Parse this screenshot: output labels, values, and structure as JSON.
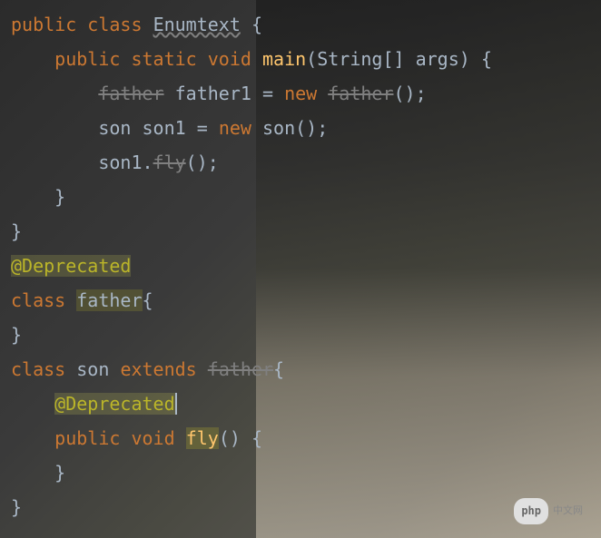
{
  "code": {
    "line1": {
      "kw_public": "public",
      "kw_class": "class",
      "classname": "Enumtext",
      "brace": "{"
    },
    "line2": {
      "kw_public": "public",
      "kw_static": "static",
      "kw_void": "void",
      "method": "main",
      "params": "(String[] args)",
      "brace": "{"
    },
    "line3": {
      "type": "father",
      "var": "father1",
      "eq": "=",
      "kw_new": "new",
      "ctor": "father",
      "call": "();"
    },
    "line4": {
      "type": "son",
      "var": "son1",
      "eq": "=",
      "kw_new": "new",
      "ctor": "son",
      "call": "();"
    },
    "line5": {
      "obj": "son1",
      "dot": ".",
      "method": "fly",
      "call": "();"
    },
    "line6": {
      "brace": "}"
    },
    "line7": {
      "brace": "}"
    },
    "line8": {
      "annotation": "@Deprecated"
    },
    "line9": {
      "kw_class": "class",
      "classname": "father",
      "brace": "{"
    },
    "line10": {
      "brace": "}"
    },
    "line11": {
      "kw_class": "class",
      "classname": "son",
      "kw_extends": "extends",
      "parent": "father",
      "brace": "{"
    },
    "line12": {
      "annotation": "@Deprecated"
    },
    "line13": {
      "kw_public": "public",
      "kw_void": "void",
      "method": "fly",
      "params": "()",
      "brace": "{"
    },
    "line14": {
      "brace": "}"
    },
    "line15": {
      "brace": "}"
    }
  },
  "watermark": {
    "logo": "php",
    "text": "中文网"
  }
}
